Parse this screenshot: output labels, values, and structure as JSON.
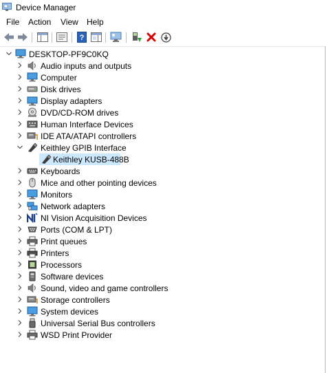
{
  "window": {
    "title": "Device Manager"
  },
  "menu": [
    "File",
    "Action",
    "View",
    "Help"
  ],
  "toolbar": {
    "buttons": [
      "back-arrow-icon",
      "forward-arrow-icon",
      "show-hide-console-tree-icon",
      "properties-icon",
      "help-icon",
      "action-pane-icon",
      "scan-hardware-icon",
      "update-driver-icon",
      "uninstall-icon",
      "disable-device-icon"
    ]
  },
  "tree": {
    "root": "DESKTOP-PF9C0KQ",
    "categories": [
      {
        "label": "Audio inputs and outputs",
        "icon": "speaker-icon",
        "expanded": false
      },
      {
        "label": "Computer",
        "icon": "computer-icon",
        "expanded": false
      },
      {
        "label": "Disk drives",
        "icon": "disk-drive-icon",
        "expanded": false
      },
      {
        "label": "Display adapters",
        "icon": "display-adapter-icon",
        "expanded": false
      },
      {
        "label": "DVD/CD-ROM drives",
        "icon": "dvd-drive-icon",
        "expanded": false
      },
      {
        "label": "Human Interface Devices",
        "icon": "hid-icon",
        "expanded": false
      },
      {
        "label": "IDE ATA/ATAPI controllers",
        "icon": "ide-controller-icon",
        "expanded": false
      },
      {
        "label": "Keithley GPIB Interface",
        "icon": "gpib-interface-icon",
        "expanded": true,
        "children": [
          {
            "label": "Keithley KUSB-488B",
            "icon": "gpib-device-icon",
            "selected": true
          }
        ]
      },
      {
        "label": "Keyboards",
        "icon": "keyboard-icon",
        "expanded": false
      },
      {
        "label": "Mice and other pointing devices",
        "icon": "mouse-icon",
        "expanded": false
      },
      {
        "label": "Monitors",
        "icon": "monitor-icon",
        "expanded": false
      },
      {
        "label": "Network adapters",
        "icon": "network-adapter-icon",
        "expanded": false
      },
      {
        "label": "NI Vision Acquisition Devices",
        "icon": "ni-logo-icon",
        "expanded": false
      },
      {
        "label": "Ports (COM & LPT)",
        "icon": "port-icon",
        "expanded": false
      },
      {
        "label": "Print queues",
        "icon": "print-queue-icon",
        "expanded": false
      },
      {
        "label": "Printers",
        "icon": "printer-icon",
        "expanded": false
      },
      {
        "label": "Processors",
        "icon": "processor-icon",
        "expanded": false
      },
      {
        "label": "Software devices",
        "icon": "software-device-icon",
        "expanded": false
      },
      {
        "label": "Sound, video and game controllers",
        "icon": "sound-controller-icon",
        "expanded": false
      },
      {
        "label": "Storage controllers",
        "icon": "storage-controller-icon",
        "expanded": false
      },
      {
        "label": "System devices",
        "icon": "system-device-icon",
        "expanded": false
      },
      {
        "label": "Universal Serial Bus controllers",
        "icon": "usb-icon",
        "expanded": false
      },
      {
        "label": "WSD Print Provider",
        "icon": "wsd-print-provider-icon",
        "expanded": false
      }
    ]
  },
  "colors": {
    "selection": "#cce8ff",
    "uninstall_red": "#d40000",
    "toolbar_blue": "#2a62b8"
  }
}
